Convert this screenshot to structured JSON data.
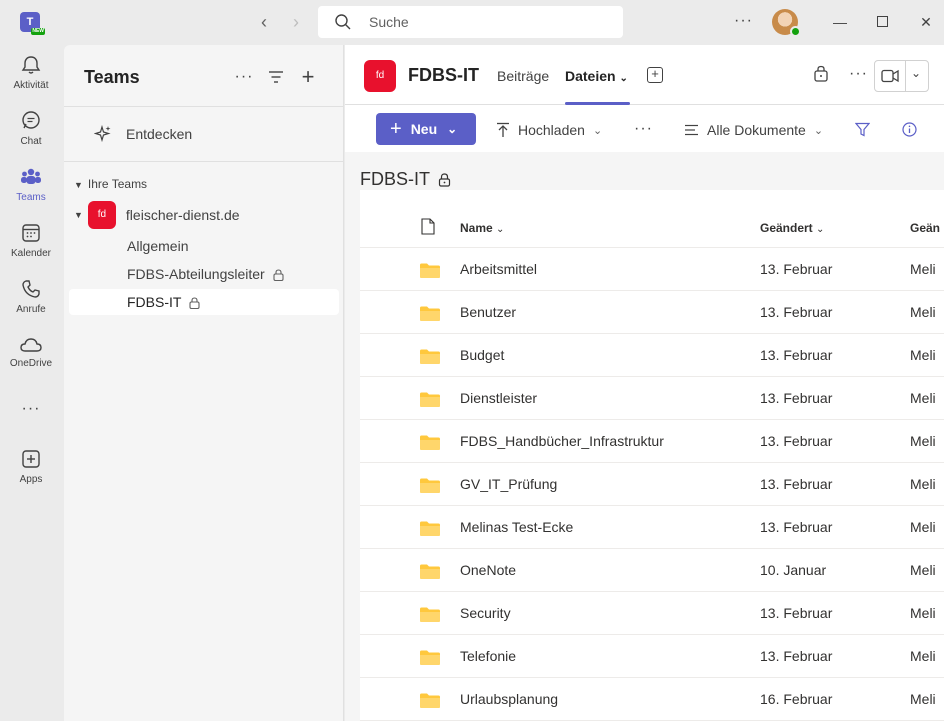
{
  "titlebar": {
    "app_logo": "T",
    "app_badge": "NEW",
    "search_placeholder": "Suche",
    "more": "···"
  },
  "rail": {
    "items": [
      {
        "label": "Aktivität",
        "icon": "bell-icon"
      },
      {
        "label": "Chat",
        "icon": "chat-icon"
      },
      {
        "label": "Teams",
        "icon": "teams-icon"
      },
      {
        "label": "Kalender",
        "icon": "calendar-icon"
      },
      {
        "label": "Anrufe",
        "icon": "phone-icon"
      },
      {
        "label": "OneDrive",
        "icon": "cloud-icon"
      },
      {
        "label": "Apps",
        "icon": "apps-add-icon"
      }
    ],
    "more": "···",
    "active": "Teams"
  },
  "panel": {
    "title": "Teams",
    "more": "···",
    "discover_label": "Entdecken",
    "section_label": "Ihre Teams",
    "team": {
      "avatar": "fd",
      "name": "fleischer-dienst.de"
    },
    "channels": [
      {
        "label": "Allgemein",
        "locked": false
      },
      {
        "label": "FDBS-Abteilungsleiter",
        "locked": true
      },
      {
        "label": "FDBS-IT",
        "locked": true,
        "active": true
      }
    ]
  },
  "main": {
    "channel_avatar": "fd",
    "channel_title": "FDBS-IT",
    "tabs": [
      {
        "label": "Beiträge",
        "active": false
      },
      {
        "label": "Dateien",
        "active": true
      }
    ],
    "header_more": "···"
  },
  "cmdbar": {
    "new_label": "Neu",
    "upload_label": "Hochladen",
    "more": "···",
    "view_label": "Alle Dokumente"
  },
  "library": {
    "title": "FDBS-IT",
    "columns": {
      "name": "Name",
      "modified": "Geändert",
      "modified_by": "Geän"
    },
    "rows": [
      {
        "name": "Arbeitsmittel",
        "modified": "13. Februar",
        "by": "Meli"
      },
      {
        "name": "Benutzer",
        "modified": "13. Februar",
        "by": "Meli"
      },
      {
        "name": "Budget",
        "modified": "13. Februar",
        "by": "Meli"
      },
      {
        "name": "Dienstleister",
        "modified": "13. Februar",
        "by": "Meli"
      },
      {
        "name": "FDBS_Handbücher_Infrastruktur",
        "modified": "13. Februar",
        "by": "Meli"
      },
      {
        "name": "GV_IT_Prüfung",
        "modified": "13. Februar",
        "by": "Meli"
      },
      {
        "name": "Melinas Test-Ecke",
        "modified": "13. Februar",
        "by": "Meli"
      },
      {
        "name": "OneNote",
        "modified": "10. Januar",
        "by": "Meli"
      },
      {
        "name": "Security",
        "modified": "13. Februar",
        "by": "Meli"
      },
      {
        "name": "Telefonie",
        "modified": "13. Februar",
        "by": "Meli"
      },
      {
        "name": "Urlaubsplanung",
        "modified": "16. Februar",
        "by": "Meli"
      }
    ]
  },
  "colors": {
    "accent": "#5b5fc7",
    "team_avatar": "#e8112d",
    "folder": "#ffc83d",
    "presence": "#13a10e"
  }
}
